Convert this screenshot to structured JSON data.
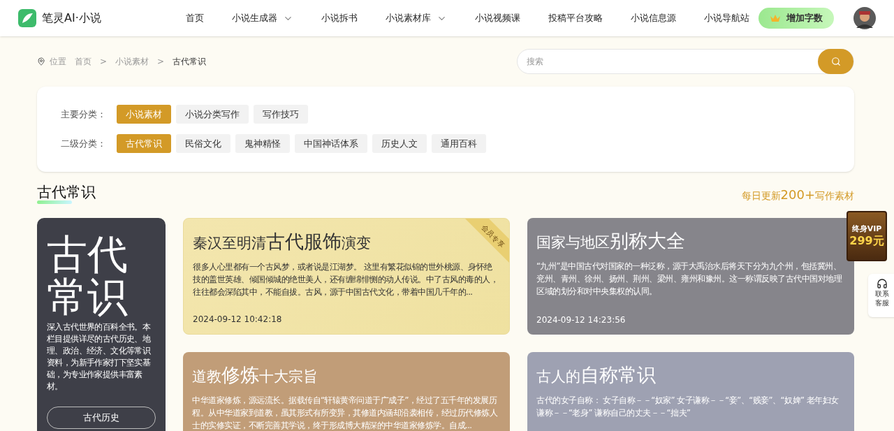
{
  "brand": {
    "name": "笔灵AI·小说"
  },
  "nav": [
    {
      "label": "首页",
      "dropdown": false
    },
    {
      "label": "小说生成器",
      "dropdown": true
    },
    {
      "label": "小说拆书",
      "dropdown": false
    },
    {
      "label": "小说素材库",
      "dropdown": true
    },
    {
      "label": "小说视频课",
      "dropdown": false
    },
    {
      "label": "投稿平台攻略",
      "dropdown": false
    },
    {
      "label": "小说信息源",
      "dropdown": false
    },
    {
      "label": "小说导航站",
      "dropdown": false
    }
  ],
  "add_words_button": "增加字数",
  "breadcrumb": {
    "label": "位置",
    "separator": ">",
    "items": [
      "首页",
      "小说素材",
      "古代常识"
    ]
  },
  "search": {
    "placeholder": "搜索"
  },
  "filters": [
    {
      "label": "主要分类：",
      "options": [
        {
          "label": "小说素材",
          "selected": true
        },
        {
          "label": "小说分类写作",
          "selected": false
        },
        {
          "label": "写作技巧",
          "selected": false
        }
      ]
    },
    {
      "label": "二级分类：",
      "options": [
        {
          "label": "古代常识",
          "selected": true
        },
        {
          "label": "民俗文化",
          "selected": false
        },
        {
          "label": "鬼神精怪",
          "selected": false
        },
        {
          "label": "中国神话体系",
          "selected": false
        },
        {
          "label": "历史人文",
          "selected": false
        },
        {
          "label": "通用百科",
          "selected": false
        }
      ]
    }
  ],
  "section": {
    "title": "古代常识",
    "update_note_pre": "每日更新",
    "update_note_count": "200+",
    "update_note_post": "写作素材"
  },
  "intro_card": {
    "title_lines": [
      "古代",
      "常识"
    ],
    "description": "深入古代世界的百科全书。本栏目提供详尽的古代历史、地理、政治、经济、文化等常识资料，为新手作家打下坚实基础，为专业作家提供丰富素材。",
    "button": "古代历史"
  },
  "cards": [
    {
      "kind": "light",
      "color": "#f3e6ae",
      "title_pre": "秦汉至明清",
      "title_main": "古代服饰",
      "title_post": "演变",
      "ribbon": "会员专享",
      "summary": "很多人心里都有一个古风梦，或者说是江湖梦。 这里有繁花似锦的世外桃源、身怀绝技的盖世英雄、倾国倾城的绝世美人，还有缠绵悱恻的动人传说。中了古风的毒的人，往往都会深陷其中，不能自拔。古风，源于中国古代文化，带着中国几千年的...",
      "date": "2024-09-12 10:42:18"
    },
    {
      "kind": "dark",
      "color": "#86858b",
      "title_pre": "国家与地区",
      "title_main": "别称大全",
      "summary": "“九州”是中国古代对国家的一种泛称，源于大禹治水后将天下分为九个州，包括冀州、兖州、青州、徐州、扬州、荆州、梁州、雍州和豫州。这一称谓反映了古代中国对地理区域的划分和对中央集权的认同。",
      "date": "2024-09-12 14:23:56"
    },
    {
      "kind": "dark",
      "color": "#c19d78",
      "title_pre": "道教",
      "title_main": "修炼",
      "title_post": "十大宗旨",
      "summary": "中华道家修炼，源远流长。据载传自“轩辕黄帝问道于广成子”，经过了五千年的发展历程。从中华道家到道教，虽其形式有所变异，其修道内涵却沿袭相传，经过历代修炼人士的实修实证，不断完善其学说，终于形成博大精深的中华道家修炼学。自成..."
    },
    {
      "kind": "dark",
      "color": "#9ea1b2",
      "title_pre": "古人的",
      "title_main": "自称常识",
      "summary": "古代的女子自称：  女子自称－－“奴家” 女子谦称－－“妾”、“贱妾”、“奴婢” 老年妇女谦称－－“老身” 谦称自己的丈夫－－“拙夫”"
    }
  ],
  "vip_badge": {
    "line1": "终身VIP",
    "line2": "299元"
  },
  "contact": {
    "label": "联系客服"
  }
}
